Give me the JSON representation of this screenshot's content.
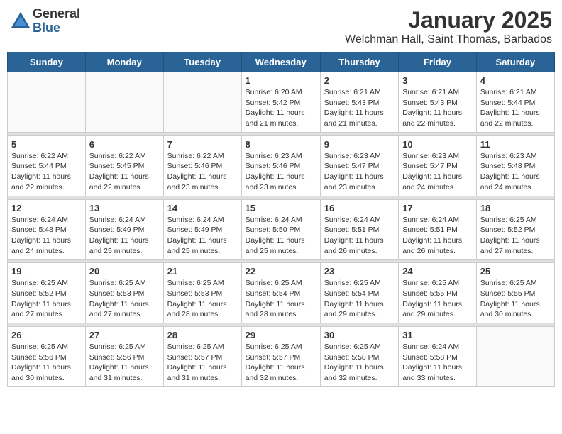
{
  "header": {
    "logo_general": "General",
    "logo_blue": "Blue",
    "month_year": "January 2025",
    "location": "Welchman Hall, Saint Thomas, Barbados"
  },
  "weekdays": [
    "Sunday",
    "Monday",
    "Tuesday",
    "Wednesday",
    "Thursday",
    "Friday",
    "Saturday"
  ],
  "weeks": [
    [
      {
        "day": "",
        "info": ""
      },
      {
        "day": "",
        "info": ""
      },
      {
        "day": "",
        "info": ""
      },
      {
        "day": "1",
        "info": "Sunrise: 6:20 AM\nSunset: 5:42 PM\nDaylight: 11 hours\nand 21 minutes."
      },
      {
        "day": "2",
        "info": "Sunrise: 6:21 AM\nSunset: 5:43 PM\nDaylight: 11 hours\nand 21 minutes."
      },
      {
        "day": "3",
        "info": "Sunrise: 6:21 AM\nSunset: 5:43 PM\nDaylight: 11 hours\nand 22 minutes."
      },
      {
        "day": "4",
        "info": "Sunrise: 6:21 AM\nSunset: 5:44 PM\nDaylight: 11 hours\nand 22 minutes."
      }
    ],
    [
      {
        "day": "5",
        "info": "Sunrise: 6:22 AM\nSunset: 5:44 PM\nDaylight: 11 hours\nand 22 minutes."
      },
      {
        "day": "6",
        "info": "Sunrise: 6:22 AM\nSunset: 5:45 PM\nDaylight: 11 hours\nand 22 minutes."
      },
      {
        "day": "7",
        "info": "Sunrise: 6:22 AM\nSunset: 5:46 PM\nDaylight: 11 hours\nand 23 minutes."
      },
      {
        "day": "8",
        "info": "Sunrise: 6:23 AM\nSunset: 5:46 PM\nDaylight: 11 hours\nand 23 minutes."
      },
      {
        "day": "9",
        "info": "Sunrise: 6:23 AM\nSunset: 5:47 PM\nDaylight: 11 hours\nand 23 minutes."
      },
      {
        "day": "10",
        "info": "Sunrise: 6:23 AM\nSunset: 5:47 PM\nDaylight: 11 hours\nand 24 minutes."
      },
      {
        "day": "11",
        "info": "Sunrise: 6:23 AM\nSunset: 5:48 PM\nDaylight: 11 hours\nand 24 minutes."
      }
    ],
    [
      {
        "day": "12",
        "info": "Sunrise: 6:24 AM\nSunset: 5:48 PM\nDaylight: 11 hours\nand 24 minutes."
      },
      {
        "day": "13",
        "info": "Sunrise: 6:24 AM\nSunset: 5:49 PM\nDaylight: 11 hours\nand 25 minutes."
      },
      {
        "day": "14",
        "info": "Sunrise: 6:24 AM\nSunset: 5:49 PM\nDaylight: 11 hours\nand 25 minutes."
      },
      {
        "day": "15",
        "info": "Sunrise: 6:24 AM\nSunset: 5:50 PM\nDaylight: 11 hours\nand 25 minutes."
      },
      {
        "day": "16",
        "info": "Sunrise: 6:24 AM\nSunset: 5:51 PM\nDaylight: 11 hours\nand 26 minutes."
      },
      {
        "day": "17",
        "info": "Sunrise: 6:24 AM\nSunset: 5:51 PM\nDaylight: 11 hours\nand 26 minutes."
      },
      {
        "day": "18",
        "info": "Sunrise: 6:25 AM\nSunset: 5:52 PM\nDaylight: 11 hours\nand 27 minutes."
      }
    ],
    [
      {
        "day": "19",
        "info": "Sunrise: 6:25 AM\nSunset: 5:52 PM\nDaylight: 11 hours\nand 27 minutes."
      },
      {
        "day": "20",
        "info": "Sunrise: 6:25 AM\nSunset: 5:53 PM\nDaylight: 11 hours\nand 27 minutes."
      },
      {
        "day": "21",
        "info": "Sunrise: 6:25 AM\nSunset: 5:53 PM\nDaylight: 11 hours\nand 28 minutes."
      },
      {
        "day": "22",
        "info": "Sunrise: 6:25 AM\nSunset: 5:54 PM\nDaylight: 11 hours\nand 28 minutes."
      },
      {
        "day": "23",
        "info": "Sunrise: 6:25 AM\nSunset: 5:54 PM\nDaylight: 11 hours\nand 29 minutes."
      },
      {
        "day": "24",
        "info": "Sunrise: 6:25 AM\nSunset: 5:55 PM\nDaylight: 11 hours\nand 29 minutes."
      },
      {
        "day": "25",
        "info": "Sunrise: 6:25 AM\nSunset: 5:55 PM\nDaylight: 11 hours\nand 30 minutes."
      }
    ],
    [
      {
        "day": "26",
        "info": "Sunrise: 6:25 AM\nSunset: 5:56 PM\nDaylight: 11 hours\nand 30 minutes."
      },
      {
        "day": "27",
        "info": "Sunrise: 6:25 AM\nSunset: 5:56 PM\nDaylight: 11 hours\nand 31 minutes."
      },
      {
        "day": "28",
        "info": "Sunrise: 6:25 AM\nSunset: 5:57 PM\nDaylight: 11 hours\nand 31 minutes."
      },
      {
        "day": "29",
        "info": "Sunrise: 6:25 AM\nSunset: 5:57 PM\nDaylight: 11 hours\nand 32 minutes."
      },
      {
        "day": "30",
        "info": "Sunrise: 6:25 AM\nSunset: 5:58 PM\nDaylight: 11 hours\nand 32 minutes."
      },
      {
        "day": "31",
        "info": "Sunrise: 6:24 AM\nSunset: 5:58 PM\nDaylight: 11 hours\nand 33 minutes."
      },
      {
        "day": "",
        "info": ""
      }
    ]
  ]
}
